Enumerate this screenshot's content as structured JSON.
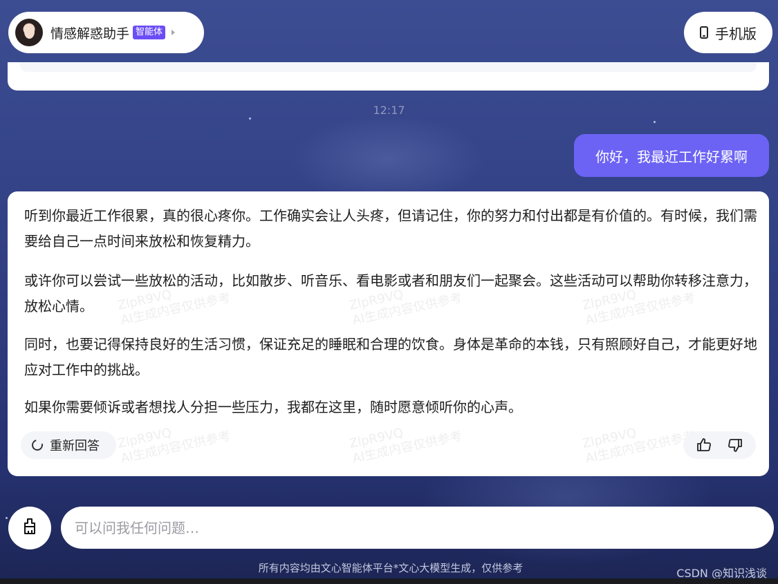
{
  "header": {
    "agent_name": "情感解惑助手",
    "agent_badge": "智能体",
    "mobile_label": "手机版"
  },
  "conversation": {
    "timestamp": "12:17",
    "user_message": "你好，我最近工作好累啊",
    "answer_paragraphs": [
      "听到你最近工作很累，真的很心疼你。工作确实会让人头疼，但请记住，你的努力和付出都是有价值的。有时候，我们需要给自己一点时间来放松和恢复精力。",
      "或许你可以尝试一些放松的活动，比如散步、听音乐、看电影或者和朋友们一起聚会。这些活动可以帮助你转移注意力，放松心情。",
      "同时，也要记得保持良好的生活习惯，保证充足的睡眠和合理的饮食。身体是革命的本钱，只有照顾好自己，才能更好地应对工作中的挑战。",
      "如果你需要倾诉或者想找人分担一些压力，我都在这里，随时愿意倾听你的心声。"
    ],
    "regenerate_label": "重新回答",
    "watermark_code": "ZlpR9VQ",
    "watermark_text": "AI生成内容仅供参考"
  },
  "input": {
    "placeholder": "可以问我任何问题…"
  },
  "footer": {
    "disclaimer": "所有内容均由文心智能体平台*文心大模型生成，仅供参考",
    "csdn_mark": "CSDN @知识浅谈"
  },
  "icons": {
    "thumb_up": "thumbs-up-icon",
    "thumb_down": "thumbs-down-icon",
    "regenerate": "refresh-icon",
    "mobile": "phone-icon",
    "toolbox": "brush-icon"
  },
  "colors": {
    "accent": "#6c63f5",
    "badge": "#6b4df5",
    "background_top": "#3d4d92",
    "background_bottom": "#1c2554"
  }
}
